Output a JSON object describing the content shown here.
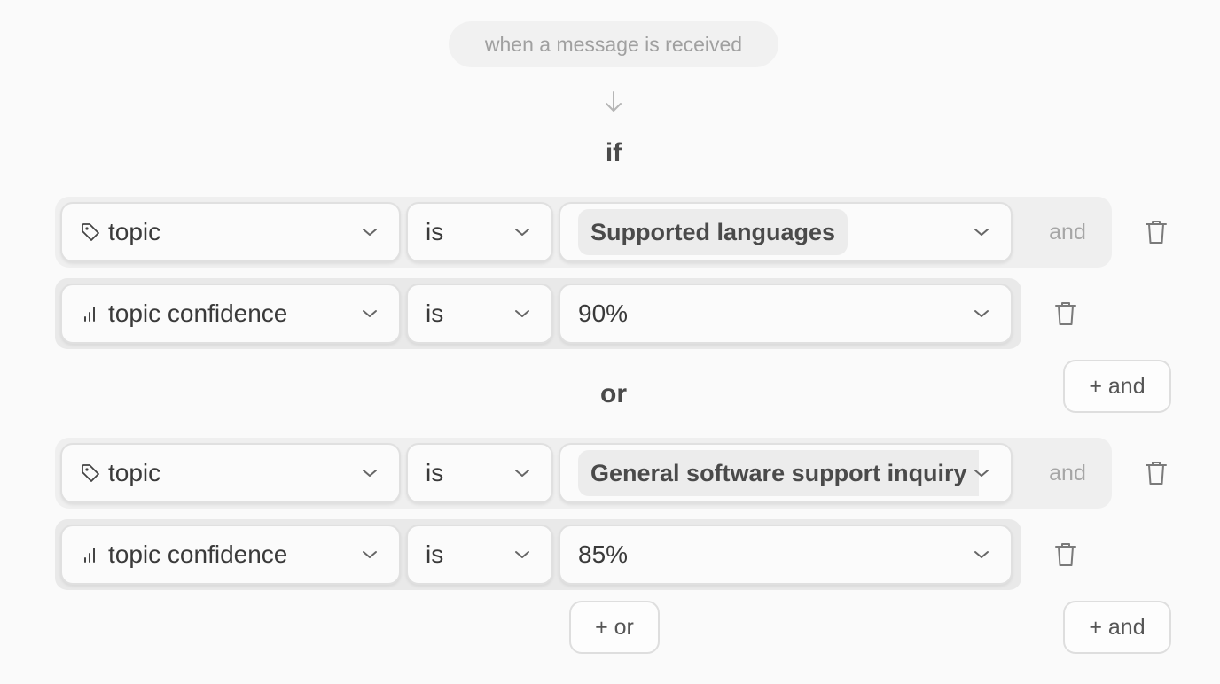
{
  "trigger": {
    "label": "when a message is received"
  },
  "labels": {
    "if": "if",
    "or": "or",
    "and": "and"
  },
  "buttons": {
    "add_and": "+ and",
    "add_or": "+ or"
  },
  "groups": [
    {
      "conditions": [
        {
          "field": "topic",
          "field_icon": "tag-icon",
          "operator": "is",
          "value": "Supported languages",
          "value_style": "chip"
        },
        {
          "field": "topic confidence",
          "field_icon": "bar-chart-icon",
          "operator": "is",
          "value": "90%",
          "value_style": "text"
        }
      ]
    },
    {
      "conditions": [
        {
          "field": "topic",
          "field_icon": "tag-icon",
          "operator": "is",
          "value": "General software support inquiry",
          "value_style": "chip"
        },
        {
          "field": "topic confidence",
          "field_icon": "bar-chart-icon",
          "operator": "is",
          "value": "85%",
          "value_style": "text"
        }
      ]
    }
  ]
}
